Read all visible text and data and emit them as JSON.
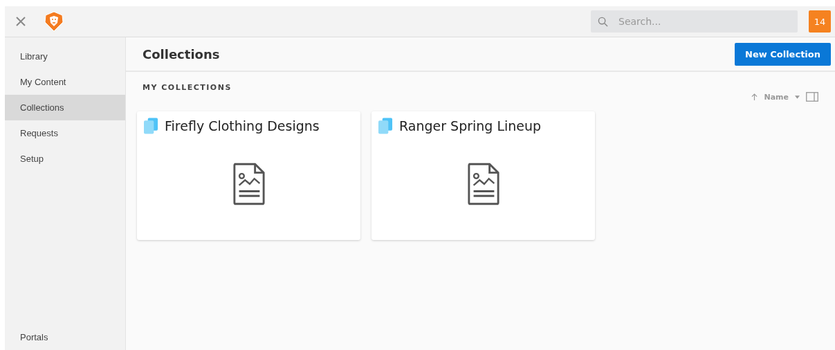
{
  "search": {
    "placeholder": "Search..."
  },
  "notification_count": "14",
  "sidebar": {
    "items": [
      {
        "label": "Library",
        "selected": false
      },
      {
        "label": "My Content",
        "selected": false
      },
      {
        "label": "Collections",
        "selected": true
      },
      {
        "label": "Requests",
        "selected": false
      },
      {
        "label": "Setup",
        "selected": false
      }
    ],
    "footer_item": "Portals"
  },
  "header": {
    "title": "Collections",
    "button": "New Collection"
  },
  "section_title": "MY COLLECTIONS",
  "sort": {
    "label": "Name"
  },
  "collections": [
    {
      "name": "Firefly Clothing Designs"
    },
    {
      "name": "Ranger Spring Lineup"
    }
  ]
}
